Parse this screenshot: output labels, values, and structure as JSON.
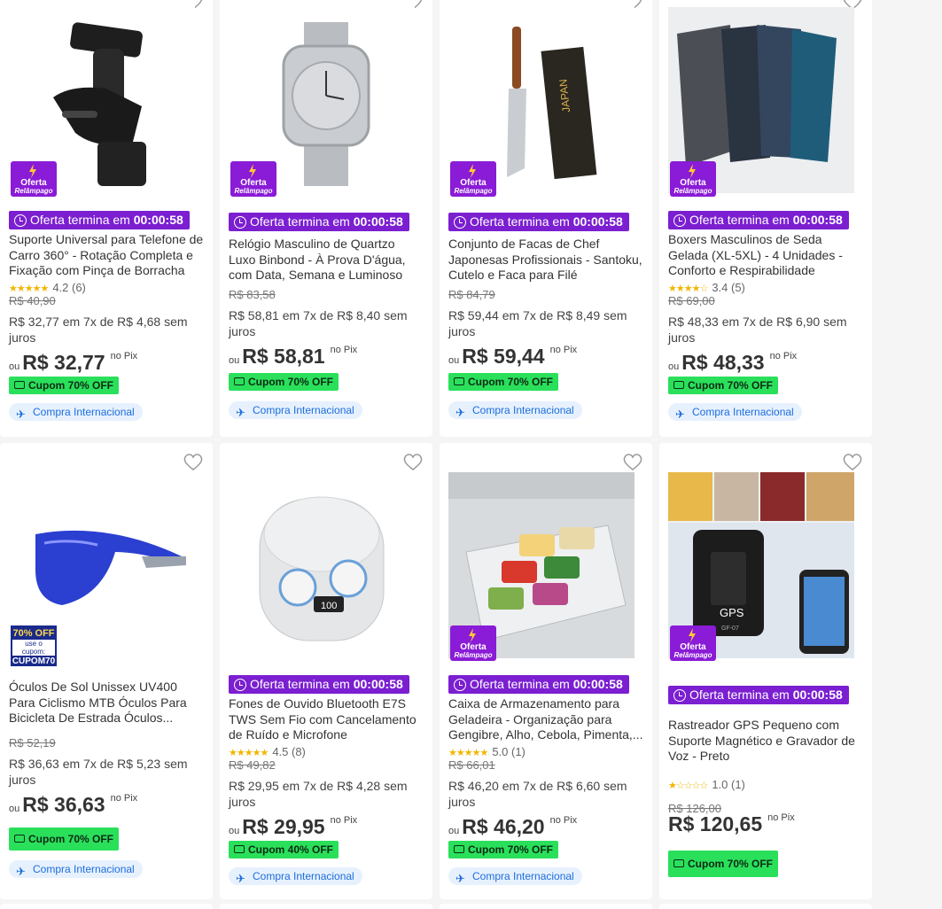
{
  "common": {
    "timer_prefix": "Oferta termina em",
    "timer_value": "00:00:58",
    "badge_line1": "Oferta",
    "badge_line2": "Relâmpago",
    "intl_label": "Compra Internacional",
    "ou": "ou",
    "pix": "no Pix"
  },
  "products": [
    {
      "title": "Suporte Universal para Telefone de Carro 360° - Rotação Completa e Fixação com Pinça de Borracha",
      "rating_value": "4.2 (6)",
      "rating_stars": "★★★★★",
      "old_price": "R$ 40,90",
      "installments": "R$ 32,77 em 7x de R$ 4,68 sem juros",
      "price": "R$ 32,77",
      "coupon": "Cupom 70% OFF"
    },
    {
      "title": "Relógio Masculino de Quartzo Luxo Binbond - À Prova D'água, com Data, Semana e Luminoso",
      "old_price": "R$ 83,58",
      "installments": "R$ 58,81 em 7x de R$ 8,40 sem juros",
      "price": "R$ 58,81",
      "coupon": "Cupom 70% OFF"
    },
    {
      "title": "Conjunto de Facas de Chef Japonesas Profissionais - Santoku, Cutelo e Faca para Filé",
      "old_price": "R$ 84,79",
      "installments": "R$ 59,44 em 7x de R$ 8,49 sem juros",
      "price": "R$ 59,44",
      "coupon": "Cupom 70% OFF"
    },
    {
      "title": "Boxers Masculinos de Seda Gelada (XL-5XL) - 4 Unidades - Conforto e Respirabilidade",
      "rating_value": "3.4 (5)",
      "rating_stars": "★★★★☆",
      "old_price": "R$ 69,00",
      "installments": "R$ 48,33 em 7x de R$ 6,90 sem juros",
      "price": "R$ 48,33",
      "coupon": "Cupom 70% OFF"
    },
    {
      "title": "Óculos De Sol Unissex UV400 Para Ciclismo MTB Óculos Para Bicicleta De Estrada Óculos...",
      "old_price": "R$ 52,19",
      "installments": "R$ 36,63 em 7x de R$ 5,23 sem juros",
      "price": "R$ 36,63",
      "coupon": "Cupom 70% OFF",
      "promo_line1": "70% OFF",
      "promo_line2": "use o cupom:",
      "promo_line3": "CUPOM70"
    },
    {
      "title": "Fones de Ouvido Bluetooth E7S TWS Sem Fio com Cancelamento de Ruído e Microfone",
      "rating_value": "4.5 (8)",
      "rating_stars": "★★★★★",
      "old_price": "R$ 49,82",
      "installments": "R$ 29,95 em 7x de R$ 4,28 sem juros",
      "price": "R$ 29,95",
      "coupon": "Cupom 40% OFF"
    },
    {
      "title": "Caixa de Armazenamento para Geladeira - Organização para Gengibre, Alho, Cebola, Pimenta,...",
      "rating_value": "5.0 (1)",
      "rating_stars": "★★★★★",
      "old_price": "R$ 66,01",
      "installments": "R$ 46,20 em 7x de R$ 6,60 sem juros",
      "price": "R$ 46,20",
      "coupon": "Cupom 70% OFF"
    },
    {
      "title": "Rastreador GPS Pequeno com Suporte Magnético e Gravador de Voz - Preto",
      "rating_value": "1.0 (1)",
      "rating_stars": "★☆☆☆☆",
      "old_price": "R$ 126,00",
      "price": "R$ 120,65",
      "coupon": "Cupom 70% OFF",
      "gps_label": "GPS",
      "gps_model": "GF-07"
    }
  ],
  "colors": {
    "flash": "#7b1fd1",
    "coupon": "#2ae05b",
    "intl": "#1d6ee0",
    "star": "#f2b600"
  }
}
